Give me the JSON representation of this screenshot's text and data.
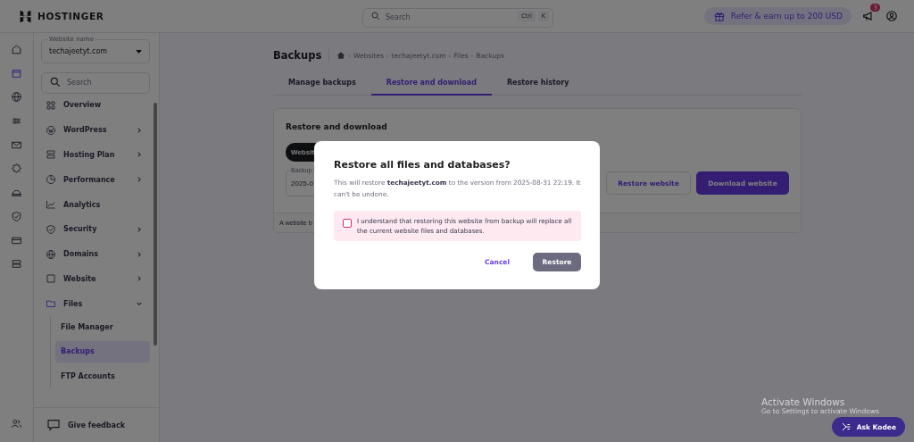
{
  "header": {
    "logo": "HOSTINGER",
    "search": {
      "placeholder": "Search",
      "keys": [
        "Ctrl",
        "K"
      ]
    },
    "refer": "Refer & earn up to 200 USD",
    "notifications": "3"
  },
  "rail": [
    {
      "selected": false
    },
    {
      "selected": true
    },
    {
      "selected": false
    },
    {
      "selected": false
    },
    {
      "selected": false
    },
    {
      "selected": false
    },
    {
      "selected": false
    },
    {
      "selected": false
    },
    {
      "selected": false
    },
    {
      "selected": false
    }
  ],
  "sidebar": {
    "website_label": "Website name",
    "website": "techajeetyt.com",
    "search_placeholder": "Search",
    "items": [
      {
        "label": "Overview",
        "kind": "link"
      },
      {
        "label": "WordPress",
        "kind": "group",
        "expanded": false
      },
      {
        "label": "Hosting Plan",
        "kind": "group",
        "expanded": false
      },
      {
        "label": "Performance",
        "kind": "group",
        "expanded": false
      },
      {
        "label": "Analytics",
        "kind": "link"
      },
      {
        "label": "Security",
        "kind": "group",
        "expanded": false
      },
      {
        "label": "Domains",
        "kind": "group",
        "expanded": false
      },
      {
        "label": "Website",
        "kind": "group",
        "expanded": false
      },
      {
        "label": "Files",
        "kind": "group",
        "expanded": true,
        "children": [
          {
            "label": "File Manager",
            "selected": false
          },
          {
            "label": "Backups",
            "selected": true
          },
          {
            "label": "FTP Accounts",
            "selected": false
          }
        ]
      }
    ],
    "feedback": "Give feedback"
  },
  "page": {
    "title": "Backups",
    "breadcrumb": [
      "Websites",
      "techajeetyt.com",
      "Files",
      "Backups"
    ],
    "breadcrumb_separator": "-",
    "tabs": [
      {
        "label": "Manage backups",
        "selected": false
      },
      {
        "label": "Restore and download",
        "selected": true
      },
      {
        "label": "Restore history",
        "selected": false
      }
    ],
    "card": {
      "title": "Restore and download",
      "pill": "Websit",
      "field_label": "Backup t",
      "field_value": "2025-0",
      "restore_button": "Restore website",
      "download_button": "Download website",
      "note": "A website b"
    }
  },
  "modal": {
    "title": "Restore all files and databases?",
    "body": "This will restore **techajeetyt.com** to the version from 2025-08-31 22:19. It can't be undone.",
    "warning": {
      "checked": false,
      "text": "I understand that restoring this website from backup will replace all the current website files and databases."
    },
    "cancel": "Cancel",
    "confirm": {
      "label": "Restore",
      "disabled": true
    }
  },
  "ask_kodee": "Ask Kodee",
  "os_notice": {
    "title": "Activate Windows",
    "subtitle": "Go to Settings to activate Windows"
  }
}
